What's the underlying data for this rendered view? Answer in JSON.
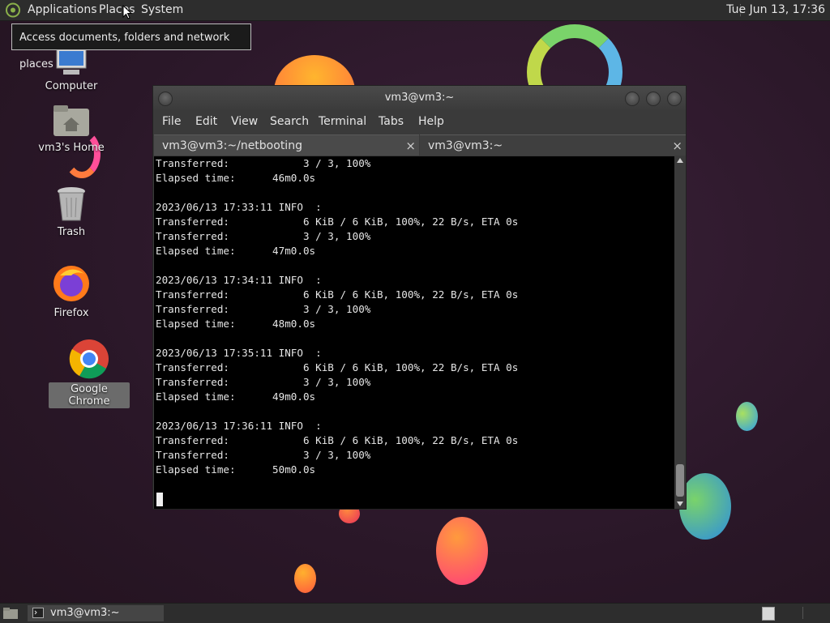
{
  "top_panel": {
    "menus": [
      "Applications",
      "Places",
      "System"
    ],
    "clock": "Tue Jun 13, 17:36"
  },
  "tooltip": "Access documents, folders and network places",
  "desktop_icons": [
    {
      "label": "Computer",
      "icon": "computer-icon"
    },
    {
      "label": "vm3's Home",
      "icon": "home-folder-icon"
    },
    {
      "label": "Trash",
      "icon": "trash-icon"
    },
    {
      "label": "Firefox",
      "icon": "firefox-icon"
    },
    {
      "label": "Google Chrome",
      "icon": "chrome-icon"
    }
  ],
  "terminal": {
    "title": "vm3@vm3:~",
    "menus": [
      "File",
      "Edit",
      "View",
      "Search",
      "Terminal",
      "Tabs",
      "Help"
    ],
    "tabs": [
      {
        "label": "vm3@vm3:~/netbooting",
        "close": "×"
      },
      {
        "label": "vm3@vm3:~",
        "close": "×"
      }
    ],
    "output": "Transferred:            3 / 3, 100%\nElapsed time:      46m0.0s\n\n2023/06/13 17:33:11 INFO  :\nTransferred:            6 KiB / 6 KiB, 100%, 22 B/s, ETA 0s\nTransferred:            3 / 3, 100%\nElapsed time:      47m0.0s\n\n2023/06/13 17:34:11 INFO  :\nTransferred:            6 KiB / 6 KiB, 100%, 22 B/s, ETA 0s\nTransferred:            3 / 3, 100%\nElapsed time:      48m0.0s\n\n2023/06/13 17:35:11 INFO  :\nTransferred:            6 KiB / 6 KiB, 100%, 22 B/s, ETA 0s\nTransferred:            3 / 3, 100%\nElapsed time:      49m0.0s\n\n2023/06/13 17:36:11 INFO  :\nTransferred:            6 KiB / 6 KiB, 100%, 22 B/s, ETA 0s\nTransferred:            3 / 3, 100%\nElapsed time:      50m0.0s"
  },
  "taskbar": {
    "window_button": "vm3@vm3:~"
  },
  "colors": {
    "panel": "#2d2d2d",
    "terminal_bg": "#000000",
    "terminal_fg": "#e6e6e6"
  }
}
